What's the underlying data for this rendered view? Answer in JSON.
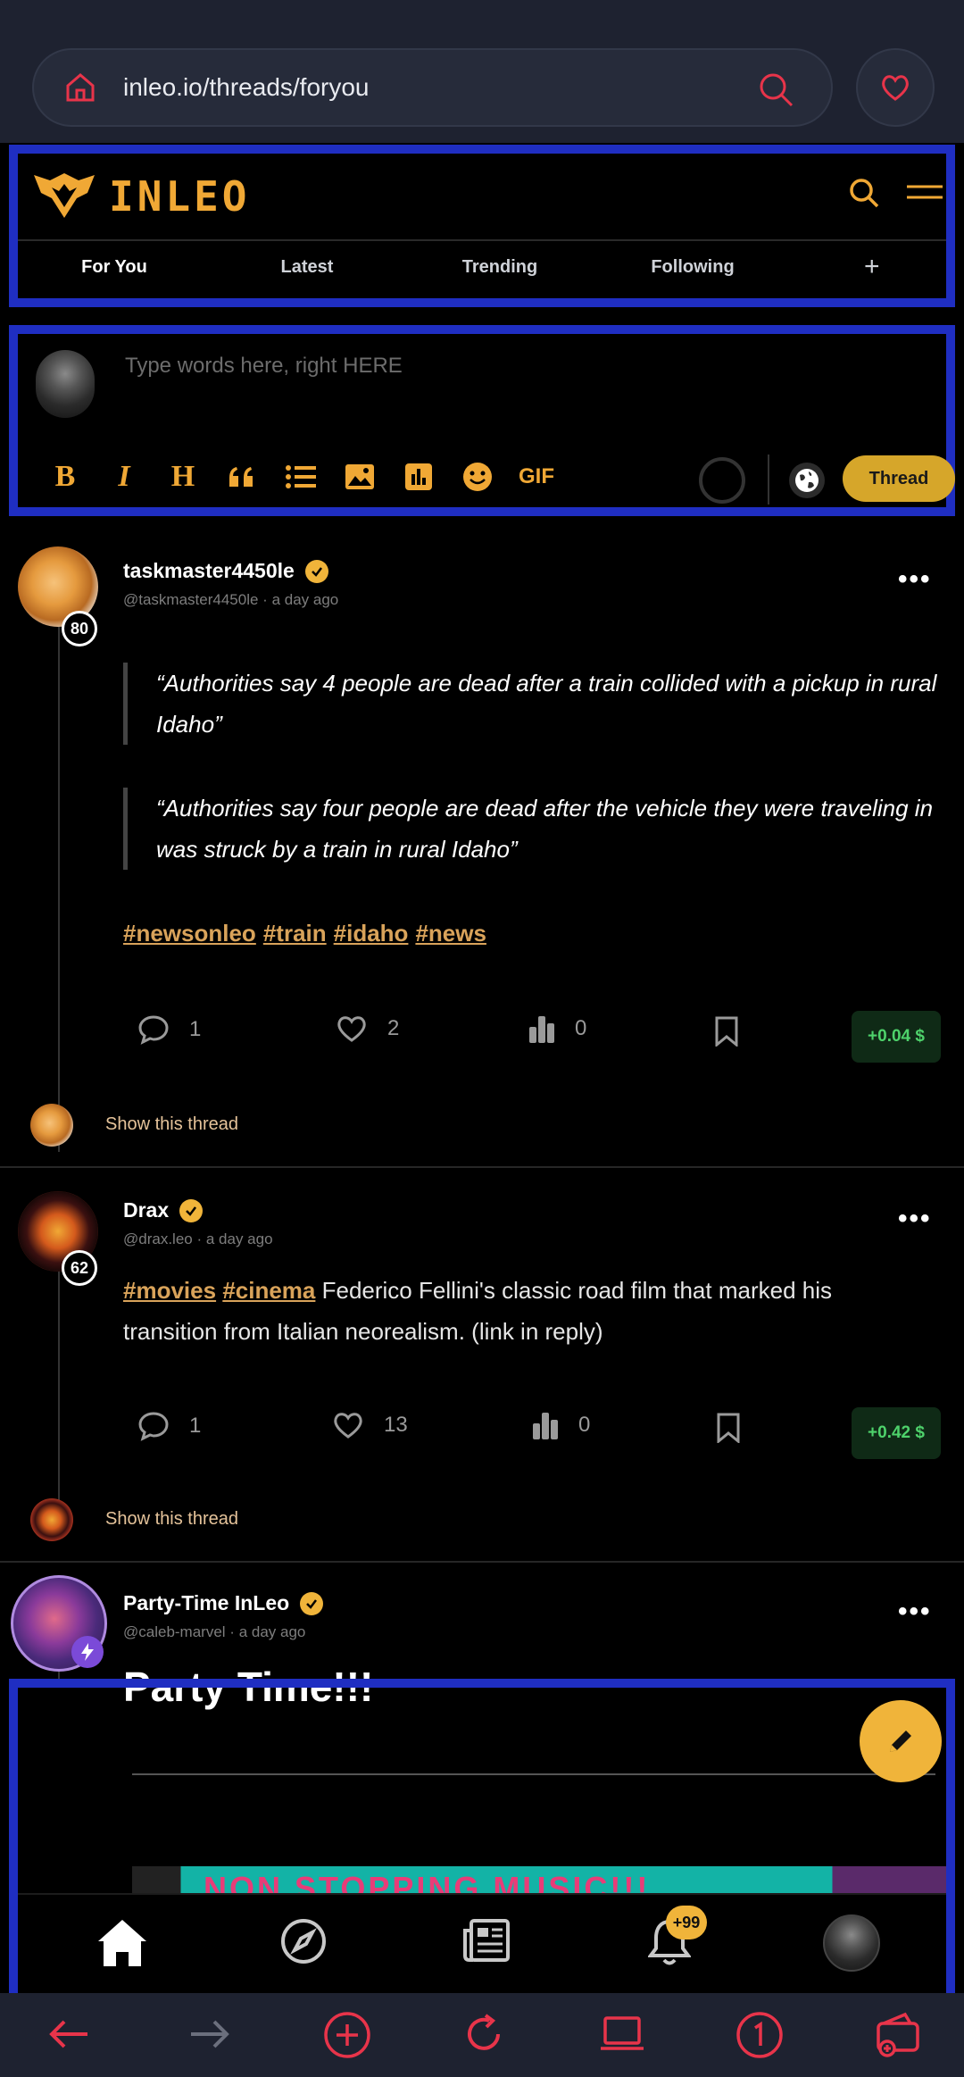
{
  "browser": {
    "url": "inleo.io/threads/foryou",
    "accent_color": "#e8344a"
  },
  "header": {
    "logo_text": "INLEO",
    "tabs": [
      {
        "label": "For You"
      },
      {
        "label": "Latest"
      },
      {
        "label": "Trending"
      },
      {
        "label": "Following"
      }
    ],
    "add_tab": "+"
  },
  "composer": {
    "placeholder": "Type words here, right HERE",
    "tools": [
      "B",
      "I",
      "H",
      "quote",
      "list",
      "image",
      "poll",
      "emoji",
      "GIF"
    ],
    "gif_label": "GIF",
    "submit_label": "Thread"
  },
  "posts": [
    {
      "author": "taskmaster4450le",
      "handle": "@taskmaster4450le",
      "time": "a day ago",
      "reputation": "80",
      "quotes": [
        "“Authorities say 4 people are dead after a train collided with a pickup in rural Idaho”",
        "“Authorities say four people are dead after the vehicle they were traveling in was struck by a train in rural Idaho”"
      ],
      "hashtags": [
        "#newsonleo",
        "#train",
        "#idaho",
        "#news"
      ],
      "comments": "1",
      "likes": "2",
      "views": "0",
      "earnings": "+0.04 $",
      "show_thread": "Show this thread"
    },
    {
      "author": "Drax",
      "handle": "@drax.leo",
      "time": "a day ago",
      "reputation": "62",
      "tag1": "#movies",
      "tag2": "#cinema",
      "text": " Federico Fellini's classic road film that marked his transition from Italian neorealism. (link in reply)",
      "comments": "1",
      "likes": "13",
      "views": "0",
      "earnings": "+0.42 $",
      "show_thread": "Show this thread"
    },
    {
      "author": "Party-Time InLeo",
      "handle": "@caleb-marvel",
      "time": "a day ago",
      "title": "Party Time!!!",
      "banner_text": "NON STOPPING MUSIC!!!"
    }
  ],
  "bottom_nav": {
    "items": [
      "home",
      "explore",
      "news",
      "notifications",
      "profile"
    ],
    "notification_count": "+99"
  },
  "meta_sep": " · ",
  "icons": {
    "brand_color": "#f0a835",
    "highlight_border": "#1f2ec2"
  }
}
